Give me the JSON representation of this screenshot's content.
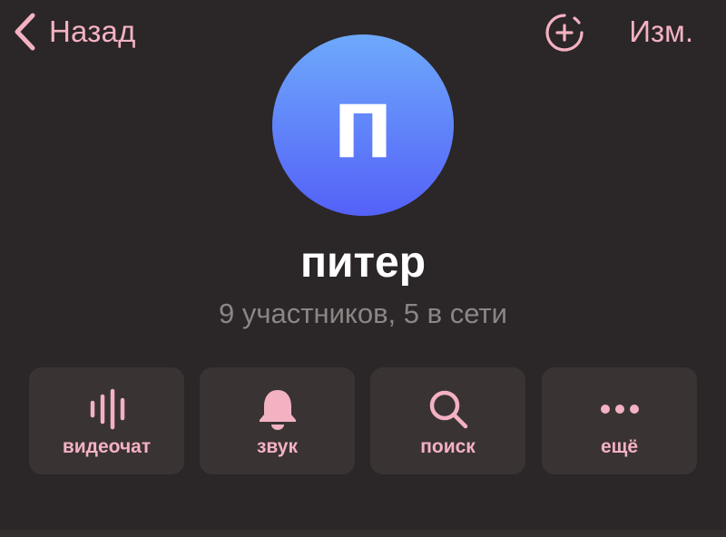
{
  "header": {
    "back_label": "Назад",
    "edit_label": "Изм."
  },
  "profile": {
    "avatar_letter": "п",
    "name": "питер",
    "members": "9 участников, 5 в сети"
  },
  "actions": [
    {
      "icon": "voice-chat-icon",
      "label": "видеочат"
    },
    {
      "icon": "bell-icon",
      "label": "звук"
    },
    {
      "icon": "search-icon",
      "label": "поиск"
    },
    {
      "icon": "more-icon",
      "label": "ещё"
    }
  ],
  "colors": {
    "accent": "#f3b2c2",
    "background": "#2b2627",
    "button_bg": "#3a3334",
    "avatar_top": "#6ea9fb",
    "avatar_bottom": "#5461f8",
    "secondary_text": "#8c8586"
  }
}
